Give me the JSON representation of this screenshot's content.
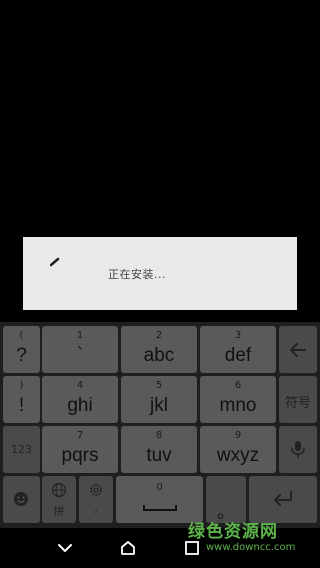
{
  "dialog": {
    "text": "正在安装..."
  },
  "keyboard": {
    "row1": [
      {
        "hint": "(",
        "main": "?"
      },
      {
        "hint": "1",
        "main": "`"
      },
      {
        "hint": "2",
        "main": "abc"
      },
      {
        "hint": "3",
        "main": "def"
      }
    ],
    "row2": [
      {
        "hint": ")",
        "main": "!"
      },
      {
        "hint": "4",
        "main": "ghi"
      },
      {
        "hint": "5",
        "main": "jkl"
      },
      {
        "hint": "6",
        "main": "mno"
      }
    ],
    "row3": [
      {
        "hint": "7",
        "main": "pqrs"
      },
      {
        "hint": "8",
        "main": "tuv"
      },
      {
        "hint": "9",
        "main": "wxyz"
      }
    ],
    "symbols_label": "符号",
    "numbers_label": "123",
    "pinyin_label": "拼",
    "comma_label": ",",
    "zero_label": "0",
    "period_label": "。",
    "space_label": "___"
  },
  "watermark": {
    "text": "绿色资源网",
    "url": "www.downcc.com"
  }
}
